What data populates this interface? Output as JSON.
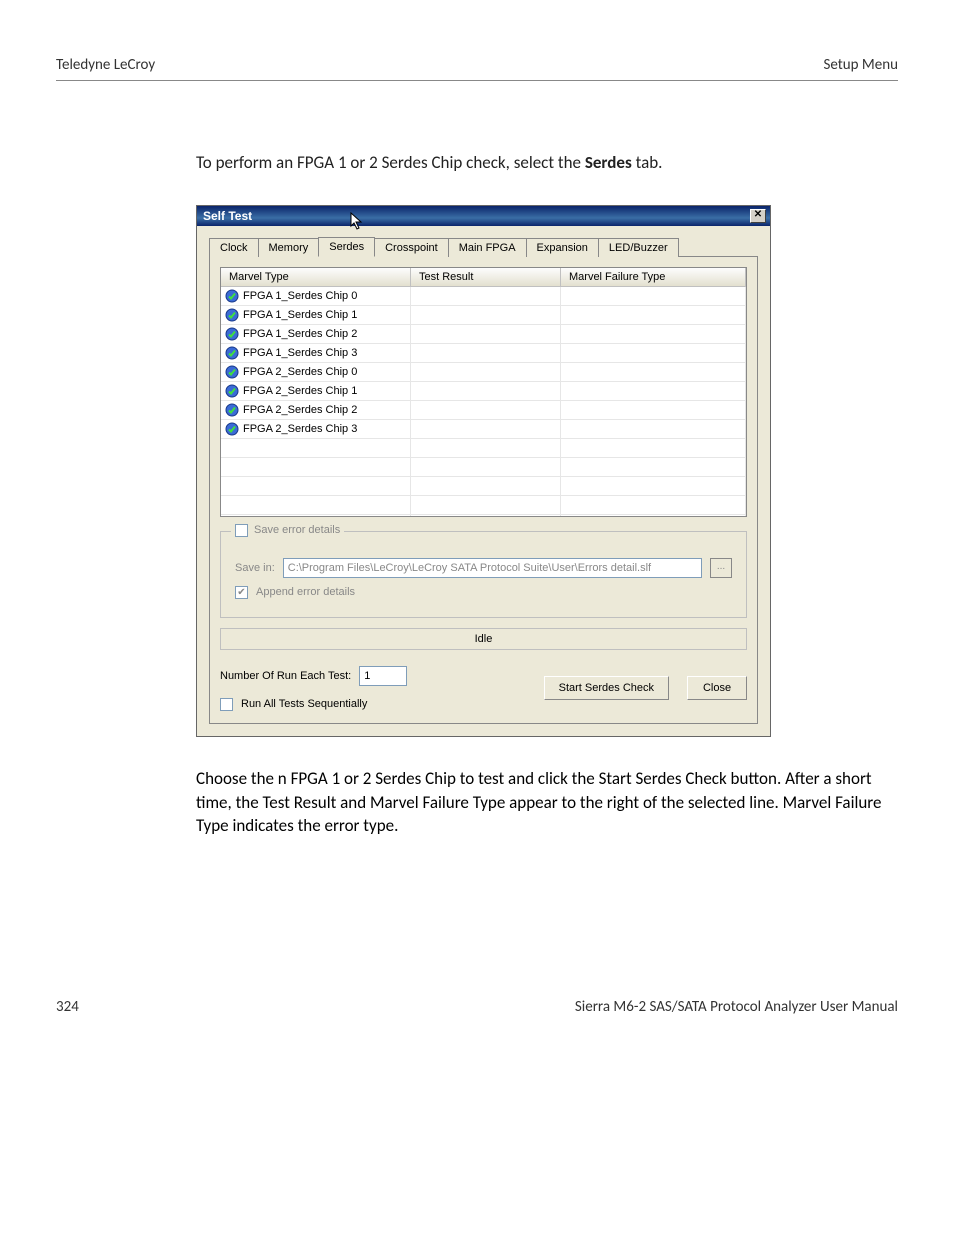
{
  "header": {
    "left": "Teledyne LeCroy",
    "right": "Setup Menu"
  },
  "intro": {
    "pre": "To perform an FPGA 1 or 2 Serdes Chip check, select the ",
    "bold": "Serdes",
    "post": " tab."
  },
  "dialog": {
    "title": "Self Test",
    "tabs": [
      "Clock",
      "Memory",
      "Serdes",
      "Crosspoint",
      "Main FPGA",
      "Expansion",
      "LED/Buzzer"
    ],
    "activeTabIndex": 2,
    "grid": {
      "headers": [
        "Marvel Type",
        "Test Result",
        "Marvel Failure Type"
      ],
      "rows": [
        {
          "label": "FPGA 1_Serdes Chip 0"
        },
        {
          "label": "FPGA 1_Serdes Chip 1"
        },
        {
          "label": "FPGA 1_Serdes Chip 2"
        },
        {
          "label": "FPGA 1_Serdes Chip 3"
        },
        {
          "label": "FPGA 2_Serdes Chip 0"
        },
        {
          "label": "FPGA 2_Serdes Chip 1"
        },
        {
          "label": "FPGA 2_Serdes Chip 2"
        },
        {
          "label": "FPGA 2_Serdes Chip 3"
        }
      ],
      "blankRows": 5
    },
    "saveGroup": {
      "legend": "Save error details",
      "saveInLabel": "Save in:",
      "path": "C:\\Program Files\\LeCroy\\LeCroy SATA Protocol Suite\\User\\Errors detail.slf",
      "browse": "...",
      "appendLabel": "Append error details"
    },
    "status": "Idle",
    "numRunLabel": "Number Of Run Each Test:",
    "numRunValue": "1",
    "runAllLabel": "Run All Tests Sequentially",
    "startBtn": "Start Serdes Check",
    "closeBtn": "Close"
  },
  "outro": {
    "p1a": "Choose the n FPGA 1 or 2 Serdes Chip to test and click the ",
    "p1b": "Start Serdes Check",
    "p1c": " button. After a short time, the Test Result and Marvel Failure Type appear to the right of the selected line. Marvel Failure Type indicates the error type."
  },
  "footer": {
    "left": "324",
    "right": "Sierra M6-2 SAS/SATA Protocol Analyzer User Manual"
  }
}
